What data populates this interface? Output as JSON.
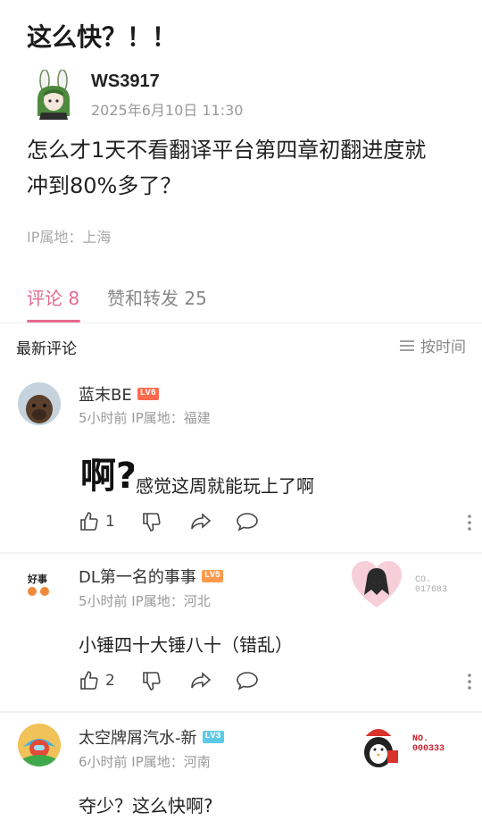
{
  "post": {
    "title": "这么快？！！",
    "author": "WS3917",
    "time": "2025年6月10日 11:30",
    "body": "怎么才1天不看翻译平台第四章初翻进度就冲到80%多了？",
    "ip": "IP属地：上海"
  },
  "tabs": [
    {
      "label": "评论 8",
      "active": true
    },
    {
      "label": "赞和转发 25",
      "active": false
    }
  ],
  "sort": {
    "title": "最新评论",
    "toggle_label": "按时间"
  },
  "comments": [
    {
      "name": "蓝末BE",
      "level": "LV6",
      "level_color": "#ff6a4d",
      "meta": "5小时前 IP属地：福建",
      "sticker_text": "啊?",
      "text": "感觉这周就能玩上了啊",
      "likes": "1"
    },
    {
      "name": "DL第一名的事事",
      "level": "LV5",
      "level_color": "#ff9a4d",
      "meta": "5小时前 IP属地：河北",
      "avatar_text": "好事",
      "text": "小锤四十大锤八十（错乱）",
      "likes": "2",
      "decor_code": "CO.\n017683"
    },
    {
      "name": "太空牌屑汽水-新",
      "level": "LV3",
      "level_color": "#5fc9e8",
      "meta": "6小时前 IP属地：河南",
      "text": "夺少？这么快啊?",
      "decor_code": "NO.\n000333"
    }
  ],
  "colors": {
    "accent": "#e56a8e",
    "muted": "#999999"
  }
}
